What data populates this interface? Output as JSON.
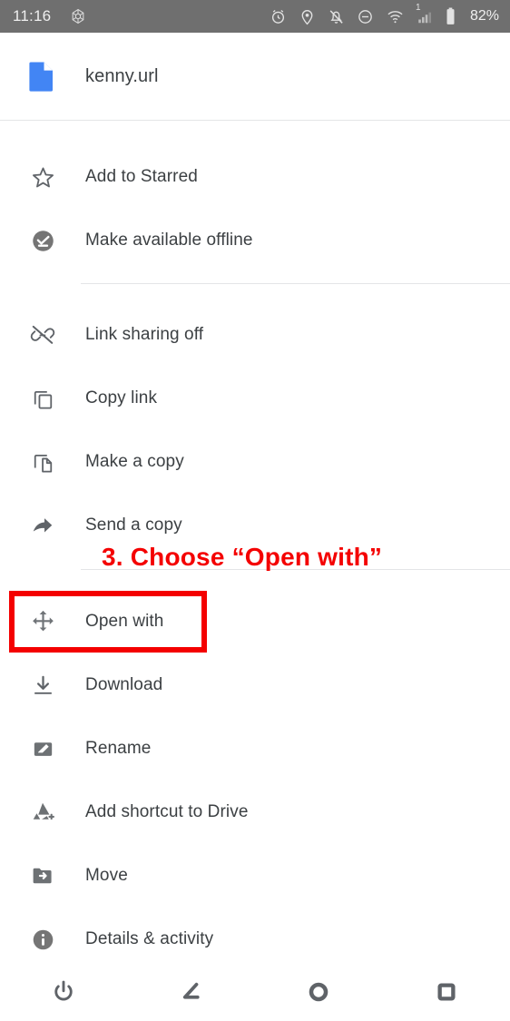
{
  "statusbar": {
    "time": "11:16",
    "app_icon": "flower-hex-icon",
    "icons": [
      "alarm-icon",
      "location-pin-icon",
      "notifications-off-icon",
      "do-not-disturb-icon",
      "wifi-icon",
      "cellular-signal-icon",
      "battery-icon"
    ],
    "signal_sim_label": "1",
    "battery_percent": "82%",
    "bg_color": "#6f6f6f"
  },
  "header": {
    "file_icon": "file-icon",
    "file_icon_color": "#4285f4",
    "title": "kenny.url"
  },
  "menu": {
    "items": [
      {
        "label": "Add to Starred",
        "icon": "star-outline-icon",
        "divider_after": false
      },
      {
        "label": "Make available offline",
        "icon": "offline-check-icon",
        "divider_after": true
      },
      {
        "label": "Link sharing off",
        "icon": "link-off-icon",
        "divider_after": false
      },
      {
        "label": "Copy link",
        "icon": "copy-icon",
        "divider_after": false
      },
      {
        "label": "Make a copy",
        "icon": "file-copy-icon",
        "divider_after": false
      },
      {
        "label": "Send a copy",
        "icon": "share-arrow-icon",
        "divider_after": true
      },
      {
        "label": "Open with",
        "icon": "open-with-icon",
        "divider_after": false
      },
      {
        "label": "Download",
        "icon": "download-icon",
        "divider_after": false
      },
      {
        "label": "Rename",
        "icon": "rename-pencil-icon",
        "divider_after": false
      },
      {
        "label": "Add shortcut to Drive",
        "icon": "drive-add-shortcut-icon",
        "divider_after": false
      },
      {
        "label": "Move",
        "icon": "move-folder-icon",
        "divider_after": false
      },
      {
        "label": "Details & activity",
        "icon": "info-icon",
        "divider_after": false
      }
    ]
  },
  "annotation": {
    "text": "3. Choose “Open with”",
    "color": "#f40000",
    "highlights_item": "Open with"
  },
  "navbar": {
    "buttons": [
      {
        "name": "power-button",
        "icon": "power-icon"
      },
      {
        "name": "back-button",
        "icon": "back-angle-icon"
      },
      {
        "name": "home-button",
        "icon": "home-circle-icon"
      },
      {
        "name": "recents-button",
        "icon": "recents-square-icon"
      }
    ]
  }
}
